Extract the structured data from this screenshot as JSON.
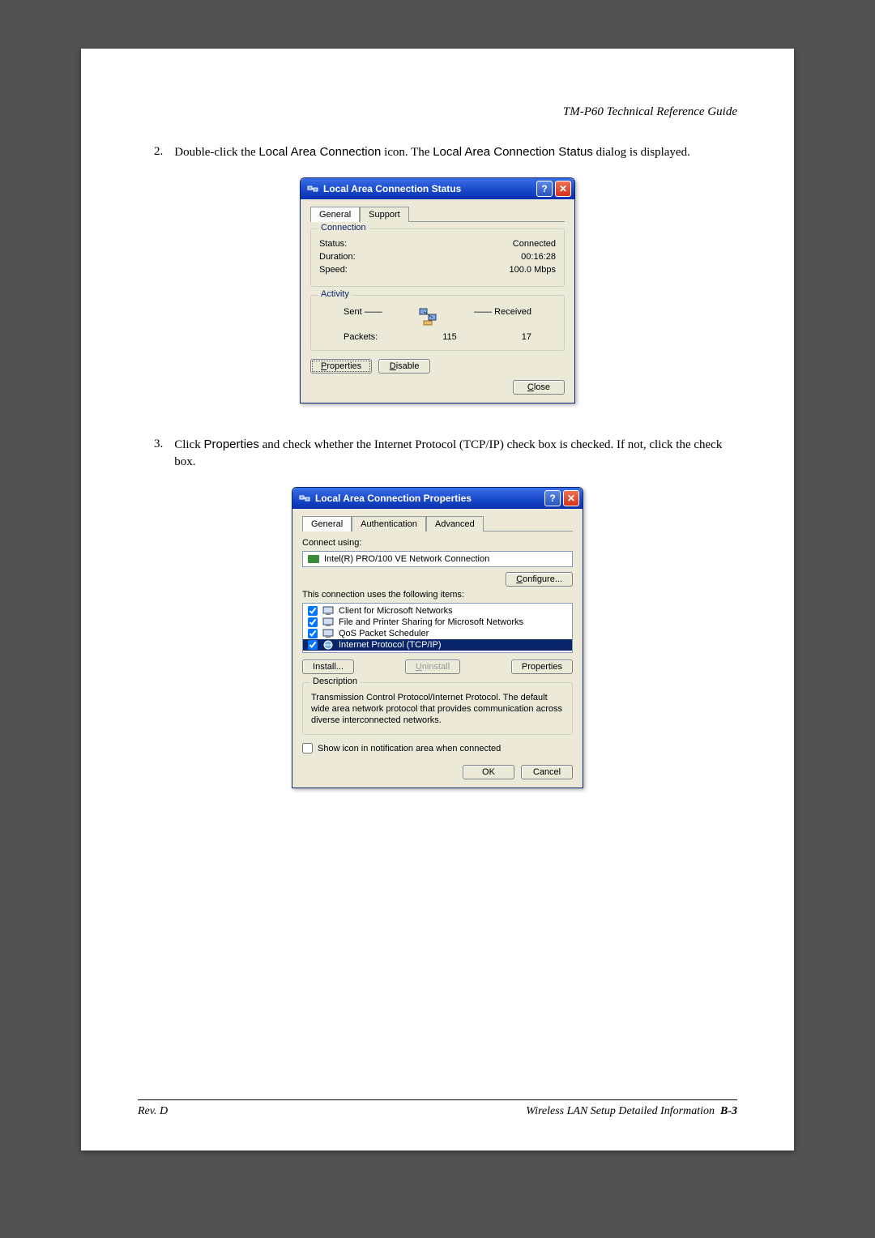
{
  "doc": {
    "header_title": "TM-P60 Technical Reference Guide",
    "step2_num": "2.",
    "step2_a": "Double-click the ",
    "step2_b": "Local Area Connection",
    "step2_c": " icon. The ",
    "step2_d": "Local Area Connection Status",
    "step2_e": " dialog is displayed.",
    "step3_num": "3.",
    "step3_a": "Click ",
    "step3_b": "Properties",
    "step3_c": " and check whether the Internet Protocol (TCP/IP) check box is checked. If not, click the check box.",
    "footer_left": "Rev. D",
    "footer_right_text": "Wireless LAN Setup Detailed Information",
    "footer_right_page": "B-3"
  },
  "status_dialog": {
    "title": "Local Area Connection Status",
    "tabs": {
      "general": "General",
      "support": "Support"
    },
    "connection": {
      "legend": "Connection",
      "status_label": "Status:",
      "status_value": "Connected",
      "duration_label": "Duration:",
      "duration_value": "00:16:28",
      "speed_label": "Speed:",
      "speed_value": "100.0 Mbps"
    },
    "activity": {
      "legend": "Activity",
      "sent_label": "Sent",
      "received_label": "Received",
      "packets_label": "Packets:",
      "sent_value": "115",
      "received_value": "17"
    },
    "buttons": {
      "properties": "Properties",
      "disable": "Disable",
      "close": "Close"
    }
  },
  "props_dialog": {
    "title": "Local Area Connection Properties",
    "tabs": {
      "general": "General",
      "auth": "Authentication",
      "advanced": "Advanced"
    },
    "connect_using_label": "Connect using:",
    "adapter_name": "Intel(R) PRO/100 VE Network Connection",
    "configure": "Configure...",
    "items_label": "This connection uses the following items:",
    "items": [
      {
        "label": "Client for Microsoft Networks",
        "checked": true
      },
      {
        "label": "File and Printer Sharing for Microsoft Networks",
        "checked": true
      },
      {
        "label": "QoS Packet Scheduler",
        "checked": true
      },
      {
        "label": "Internet Protocol (TCP/IP)",
        "checked": true,
        "selected": true
      }
    ],
    "buttons": {
      "install": "Install...",
      "uninstall": "Uninstall",
      "properties": "Properties",
      "ok": "OK",
      "cancel": "Cancel"
    },
    "description": {
      "legend": "Description",
      "text": "Transmission Control Protocol/Internet Protocol. The default wide area network protocol that provides communication across diverse interconnected networks."
    },
    "show_icon_label": "Show icon in notification area when connected"
  }
}
